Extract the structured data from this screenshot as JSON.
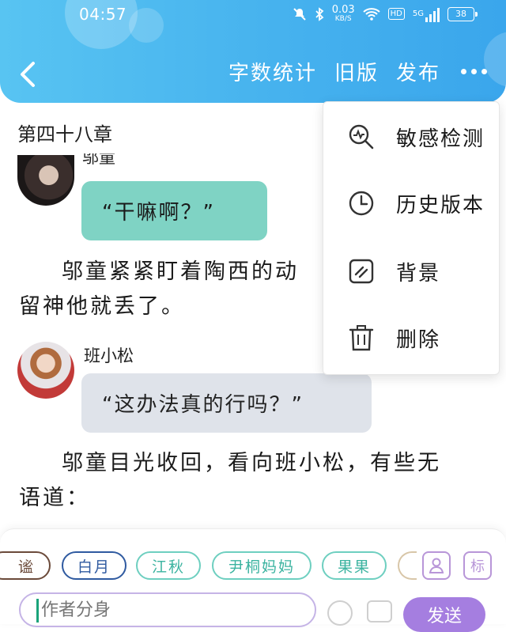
{
  "status_bar": {
    "time": "04:57",
    "net_speed_value": "0.03",
    "net_speed_unit": "KB/S",
    "hd": "HD",
    "signal": "5G",
    "battery": "38"
  },
  "nav": {
    "word_count": "字数统计",
    "old_version": "旧版",
    "publish": "发布"
  },
  "chapter": {
    "title": "第四十八章"
  },
  "messages": [
    {
      "speaker": "邬童",
      "text": "“干嘛啊？”",
      "bubble_color": "#7fd3c4"
    },
    {
      "speaker": "班小松",
      "text": "“这办法真的行吗？”",
      "bubble_color": "#dfe3ea"
    }
  ],
  "paragraphs": [
    "邬童紧紧盯着陶西的动",
    "留神他就丢了。",
    "邬童目光收回，看向班小松，有些无",
    "语道："
  ],
  "menu": {
    "items": [
      {
        "label": "敏感检测",
        "icon": "search-wave-icon"
      },
      {
        "label": "历史版本",
        "icon": "clock-icon"
      },
      {
        "label": "背景",
        "icon": "background-icon"
      },
      {
        "label": "删除",
        "icon": "trash-icon"
      }
    ]
  },
  "characters": [
    {
      "label": "谧",
      "color": "#6b4a3a"
    },
    {
      "label": "白月",
      "color": "#2f5aa0"
    },
    {
      "label": "江秋",
      "color": "#6ecfc0"
    },
    {
      "label": "尹桐妈妈",
      "color": "#6ecfc0"
    },
    {
      "label": "果果",
      "color": "#6ecfc0"
    }
  ],
  "tag_button": "标",
  "input": {
    "placeholder": "作者分身"
  },
  "send_label": "发送",
  "colors": {
    "accent": "#46b2ee",
    "send": "#a57ee0"
  }
}
